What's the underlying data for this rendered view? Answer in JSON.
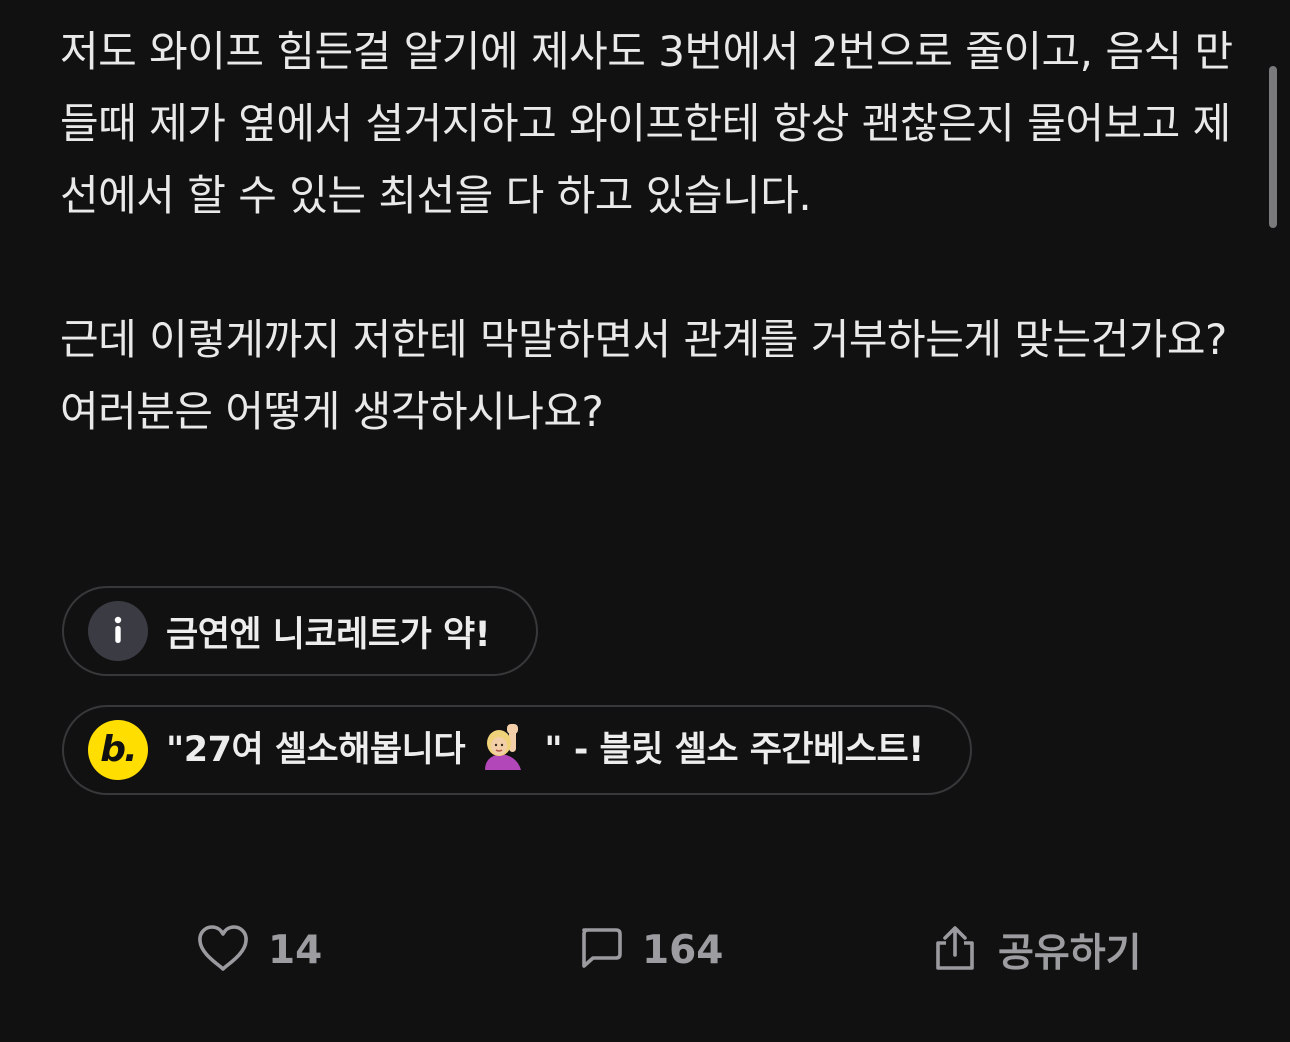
{
  "post": {
    "paragraphs": [
      "저도 와이프 힘든걸 알기에 제사도 3번에서 2번으로 줄이고, 음식 만들때 제가 옆에서 설거지하고 와이프한테 항상 괜찮은지 물어보고 제 선에서 할 수 있는 최선을 다 하고 있습니다.",
      "근데 이렇게까지 저한테 막말하면서 관계를 거부하는게 맞는건가요?",
      "여러분은 어떻게 생각하시나요?"
    ]
  },
  "banners": [
    {
      "icon": "info-icon",
      "text": "금연엔 니코레트가 약!"
    },
    {
      "icon": "blind-logo-icon",
      "logo_letter": "b.",
      "text_before": "\"27여 셀소해봅니다",
      "emoji": "raising-hand-emoji",
      "text_after": "\" - 블릿 셀소 주간베스트!"
    }
  ],
  "actions": {
    "like": {
      "icon": "heart-icon",
      "count": "14"
    },
    "comment": {
      "icon": "comment-icon",
      "count": "164"
    },
    "share": {
      "icon": "share-icon",
      "label": "공유하기"
    }
  },
  "colors": {
    "background": "#111112",
    "text": "#e9e9e9",
    "muted": "#9b9b9f",
    "blind_yellow": "#ffde00"
  }
}
